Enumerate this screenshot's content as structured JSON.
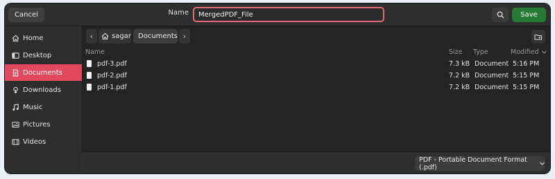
{
  "header": {
    "cancel_label": "Cancel",
    "name_label": "Name",
    "name_value": "MergedPDF_File",
    "save_label": "Save"
  },
  "sidebar": {
    "items": [
      {
        "label": "Home",
        "icon": "home-icon"
      },
      {
        "label": "Desktop",
        "icon": "desktop-icon"
      },
      {
        "label": "Documents",
        "icon": "documents-icon",
        "active": true
      },
      {
        "label": "Downloads",
        "icon": "downloads-icon"
      },
      {
        "label": "Music",
        "icon": "music-icon"
      },
      {
        "label": "Pictures",
        "icon": "pictures-icon"
      },
      {
        "label": "Videos",
        "icon": "videos-icon"
      }
    ]
  },
  "pathbar": {
    "home_label": "sagar",
    "current_label": "Documents"
  },
  "columns": {
    "name": "Name",
    "size": "Size",
    "type": "Type",
    "modified": "Modified"
  },
  "files": [
    {
      "name": "pdf-3.pdf",
      "size": "7.3 kB",
      "type": "Document",
      "modified": "5:16 PM"
    },
    {
      "name": "pdf-2.pdf",
      "size": "7.2 kB",
      "type": "Document",
      "modified": "5:15 PM"
    },
    {
      "name": "pdf-1.pdf",
      "size": "7.2 kB",
      "type": "Document",
      "modified": "5:15 PM"
    }
  ],
  "footer": {
    "filter_label": "PDF - Portable Document Format (.pdf)"
  },
  "colors": {
    "accent": "#e0495e",
    "save": "#267a33",
    "input_focus": "#e26a7d"
  }
}
